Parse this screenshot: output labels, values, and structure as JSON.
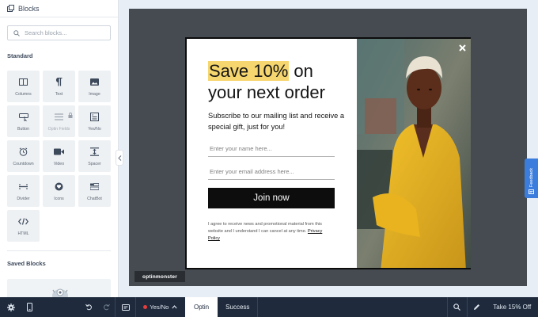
{
  "sidebar": {
    "title": "Blocks",
    "search_placeholder": "Search blocks...",
    "standard_title": "Standard",
    "saved_title": "Saved Blocks",
    "blocks": [
      {
        "label": "Columns",
        "icon": "columns-icon"
      },
      {
        "label": "Text",
        "icon": "paragraph-icon"
      },
      {
        "label": "Image",
        "icon": "image-icon"
      },
      {
        "label": "Button",
        "icon": "button-icon"
      },
      {
        "label": "Optin Fields",
        "icon": "optin-fields-icon",
        "locked": true
      },
      {
        "label": "Yes/No",
        "icon": "yes-no-icon"
      },
      {
        "label": "Countdown",
        "icon": "countdown-icon"
      },
      {
        "label": "Video",
        "icon": "video-icon"
      },
      {
        "label": "Spacer",
        "icon": "spacer-icon"
      },
      {
        "label": "Divider",
        "icon": "divider-icon"
      },
      {
        "label": "Icons",
        "icon": "icons-icon"
      },
      {
        "label": "ChatBot",
        "icon": "chatbot-icon"
      },
      {
        "label": "HTML",
        "icon": "html-code-icon"
      }
    ]
  },
  "popup": {
    "headline_highlight": "Save 10%",
    "headline_rest1": " on",
    "headline_line2": "your next order",
    "subtext": "Subscribe to our mailing list and receive a special gift, just for you!",
    "name_placeholder": "Enter your name here...",
    "email_placeholder": "Enter your email address here...",
    "button_label": "Join now",
    "consent_text": "I agree to receive news and promotional material from this website and I understand I can cancel at any time.",
    "privacy_link": "Privacy Policy",
    "highlight_color": "#f6d66e"
  },
  "branding": {
    "logo_text": "optinmonster"
  },
  "feedback": {
    "label": "Feedback"
  },
  "bottombar": {
    "yesno_label": "Yes/No",
    "tabs": [
      "Optin",
      "Success"
    ],
    "active_tab": "Optin",
    "campaign_name": "Take 15% Off"
  },
  "colors": {
    "bottombar": "#1f2b3d",
    "canvas": "#454b51",
    "feedback": "#3b7ddd"
  }
}
